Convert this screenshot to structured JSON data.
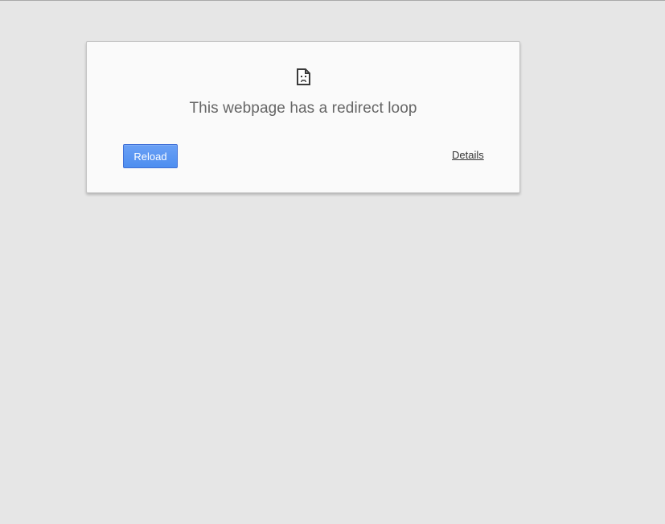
{
  "error": {
    "icon": "sad-page-icon",
    "title": "This webpage has a redirect loop",
    "reload_label": "Reload",
    "details_label": "Details"
  },
  "colors": {
    "page_background": "#e6e6e6",
    "card_background": "#fafafa",
    "title_text": "#666666",
    "button_blue": "#4d8ef0",
    "link_text": "#333333"
  }
}
